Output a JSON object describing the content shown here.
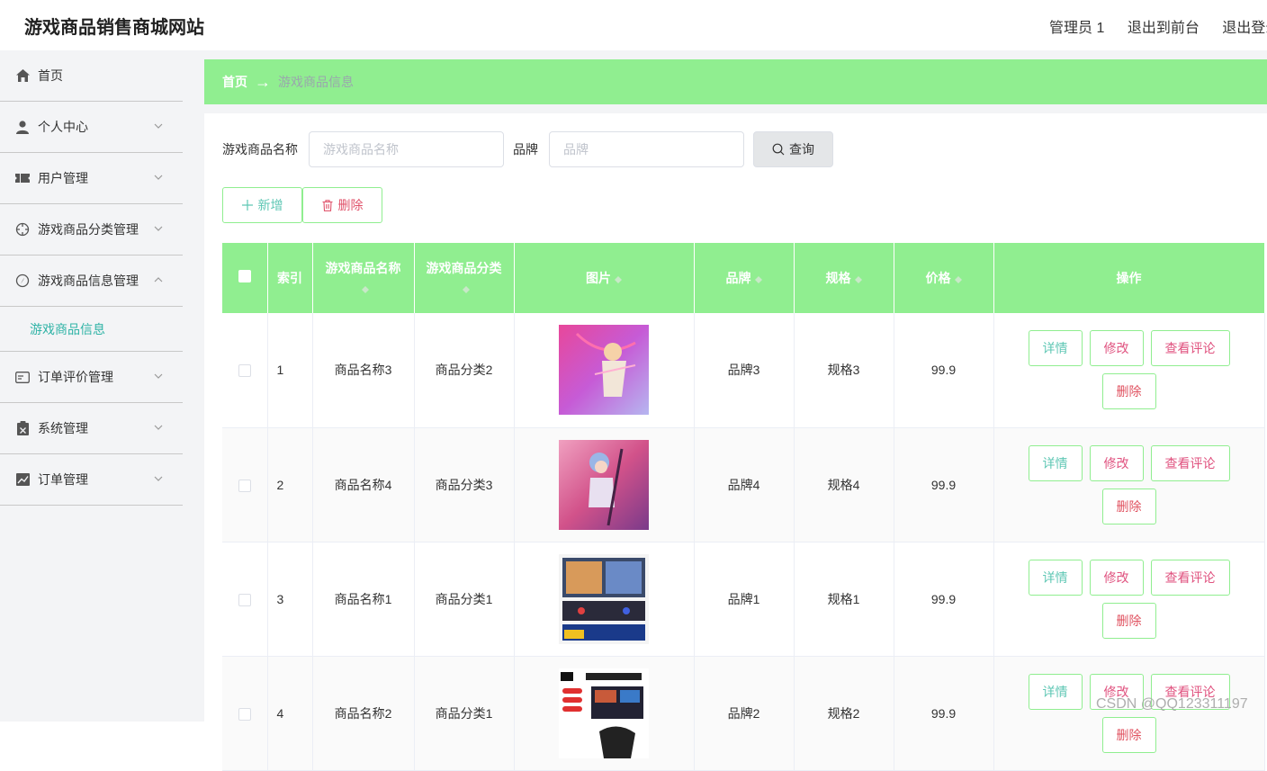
{
  "header": {
    "site_title": "游戏商品销售商城网站",
    "links": [
      "管理员 1",
      "退出到前台",
      "退出登录"
    ]
  },
  "sidebar": {
    "items": [
      {
        "label": "首页",
        "icon": "home-icon"
      },
      {
        "label": "个人中心",
        "icon": "user-icon"
      },
      {
        "label": "用户管理",
        "icon": "ticket-icon"
      },
      {
        "label": "游戏商品分类管理",
        "icon": "target-icon"
      },
      {
        "label": "游戏商品信息管理",
        "icon": "compass-icon"
      },
      {
        "label": "订单评价管理",
        "icon": "card-icon"
      },
      {
        "label": "系统管理",
        "icon": "clipboard-icon"
      },
      {
        "label": "订单管理",
        "icon": "chart-icon"
      }
    ],
    "submenu_active": "游戏商品信息"
  },
  "breadcrumb": {
    "home": "首页",
    "arrow": "→",
    "current": "游戏商品信息"
  },
  "search": {
    "name_label": "游戏商品名称",
    "name_placeholder": "游戏商品名称",
    "brand_label": "品牌",
    "brand_placeholder": "品牌",
    "query_label": "查询"
  },
  "actions": {
    "add_label": "新增",
    "delete_label": "删除"
  },
  "table": {
    "columns": [
      "索引",
      "游戏商品名称",
      "游戏商品分类",
      "图片",
      "品牌",
      "规格",
      "价格",
      "操作"
    ],
    "rows": [
      {
        "index": "1",
        "name": "商品名称3",
        "category": "商品分类2",
        "brand": "品牌3",
        "spec": "规格3",
        "price": "99.9"
      },
      {
        "index": "2",
        "name": "商品名称4",
        "category": "商品分类3",
        "brand": "品牌4",
        "spec": "规格4",
        "price": "99.9"
      },
      {
        "index": "3",
        "name": "商品名称1",
        "category": "商品分类1",
        "brand": "品牌1",
        "spec": "规格1",
        "price": "99.9"
      },
      {
        "index": "4",
        "name": "商品名称2",
        "category": "商品分类1",
        "brand": "品牌2",
        "spec": "规格2",
        "price": "99.9"
      }
    ],
    "ops": {
      "detail": "详情",
      "edit": "修改",
      "view_comments": "查看评论",
      "delete": "删除"
    }
  },
  "watermark": "CSDN @QQ123311197",
  "colors": {
    "accent_green": "#90ee90",
    "teal_text": "#5fc7b4",
    "pink_text": "#e0527f"
  }
}
